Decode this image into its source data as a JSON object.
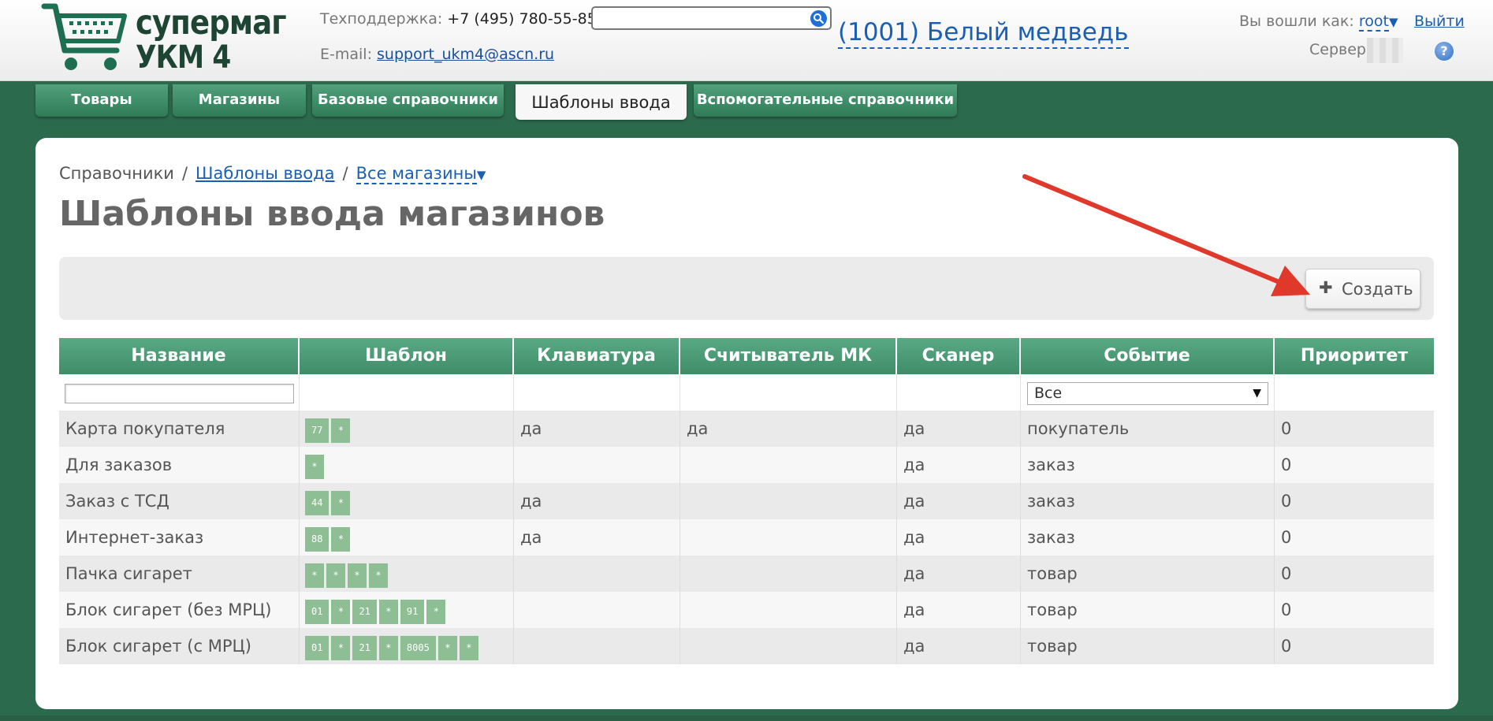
{
  "brand": {
    "line1": "супермаг",
    "line2": "УКМ 4"
  },
  "support": {
    "label": "Техподдержка:",
    "phone": "+7 (495) 780-55-85",
    "email_label": "E-mail:",
    "email": "support_ukm4@ascn.ru"
  },
  "search": {
    "placeholder": ""
  },
  "store": {
    "name": "(1001) Белый медведь"
  },
  "user": {
    "logged_as_label": "Вы вошли как:",
    "username": "root",
    "logout": "Выйти",
    "server_label": "Сервер:"
  },
  "tabs": [
    {
      "label": "Товары"
    },
    {
      "label": "Магазины"
    },
    {
      "label": "Базовые справочники"
    },
    {
      "label": "Шаблоны ввода",
      "active": true
    },
    {
      "label": "Вспомогательные справочники"
    }
  ],
  "breadcrumb": {
    "root": "Справочники",
    "section": "Шаблоны ввода",
    "scope": "Все магазины"
  },
  "page_title": "Шаблоны ввода магазинов",
  "toolbar": {
    "create_label": "Создать"
  },
  "table": {
    "columns": [
      "Название",
      "Шаблон",
      "Клавиатура",
      "Считыватель МК",
      "Сканер",
      "Событие",
      "Приоритет"
    ],
    "event_filter_value": "Все",
    "rows": [
      {
        "name": "Карта покупателя",
        "template": [
          "77",
          "*"
        ],
        "keyboard": "да",
        "msr": "да",
        "scanner": "да",
        "event": "покупатель",
        "priority": "0"
      },
      {
        "name": "Для заказов",
        "template": [
          "*"
        ],
        "keyboard": "",
        "msr": "",
        "scanner": "да",
        "event": "заказ",
        "priority": "0"
      },
      {
        "name": "Заказ с ТСД",
        "template": [
          "44",
          "*"
        ],
        "keyboard": "да",
        "msr": "",
        "scanner": "да",
        "event": "заказ",
        "priority": "0"
      },
      {
        "name": "Интернет-заказ",
        "template": [
          "88",
          "*"
        ],
        "keyboard": "да",
        "msr": "",
        "scanner": "да",
        "event": "заказ",
        "priority": "0"
      },
      {
        "name": "Пачка сигарет",
        "template": [
          "*",
          "*",
          "*",
          "*"
        ],
        "keyboard": "",
        "msr": "",
        "scanner": "да",
        "event": "товар",
        "priority": "0"
      },
      {
        "name": "Блок сигарет (без МРЦ)",
        "template": [
          "01",
          "*",
          "21",
          "*",
          "91",
          "*"
        ],
        "keyboard": "",
        "msr": "",
        "scanner": "да",
        "event": "товар",
        "priority": "0"
      },
      {
        "name": "Блок сигарет (с МРЦ)",
        "template": [
          "01",
          "*",
          "21",
          "*",
          "8005",
          "*",
          "*"
        ],
        "keyboard": "",
        "msr": "",
        "scanner": "да",
        "event": "товар",
        "priority": "0"
      }
    ]
  },
  "colors": {
    "brand_green": "#2c6a4d",
    "header_green": "#4a9a74",
    "chip_green": "#8dbe94",
    "link_blue": "#1a5fb4",
    "annotation_red": "#e0392b"
  },
  "icons": [
    "shopping-cart-icon",
    "search-icon",
    "caret-down-icon",
    "help-icon",
    "plus-icon",
    "red-arrow-annotation"
  ]
}
